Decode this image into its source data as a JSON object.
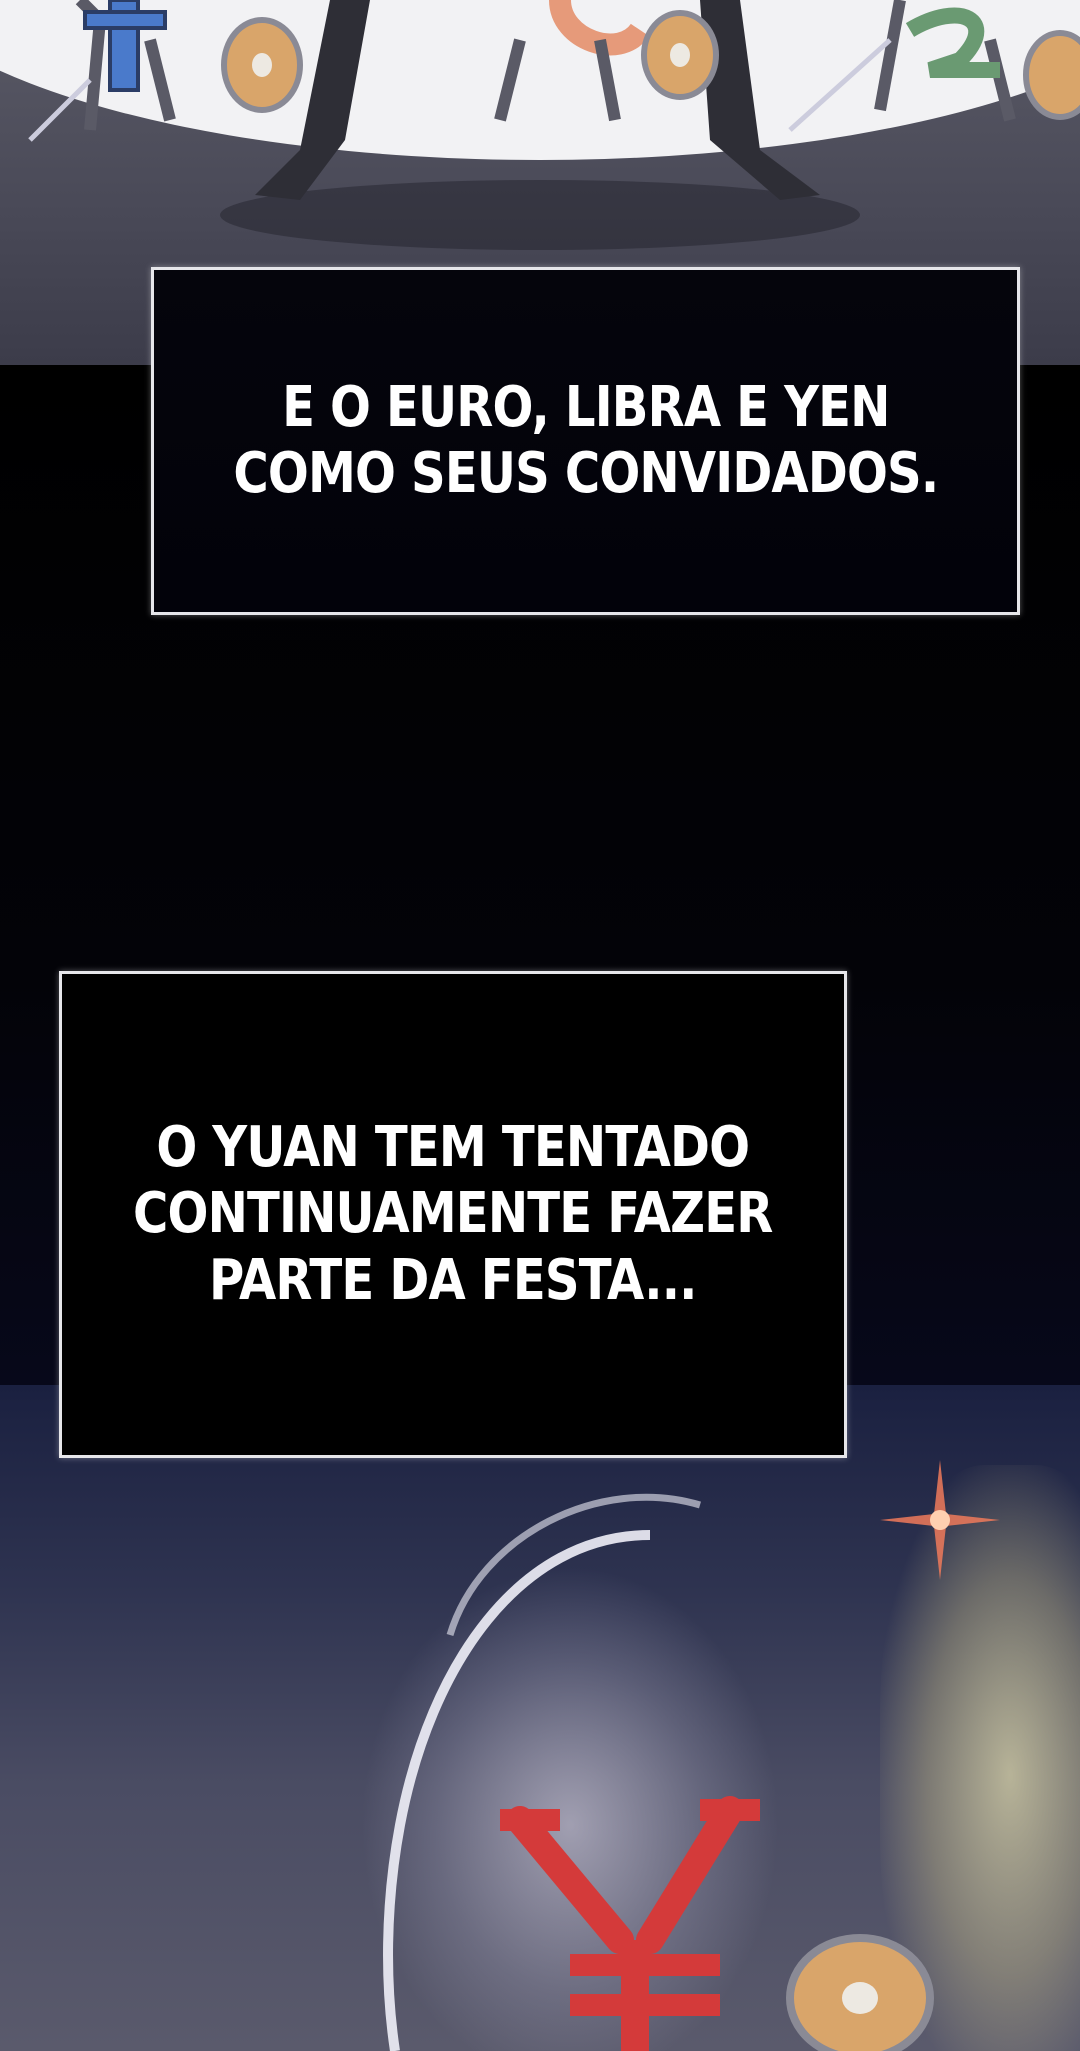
{
  "captions": [
    {
      "lines": [
        "E O EURO, LIBRA E YEN",
        "COMO SEUS CONVIDADOS."
      ]
    },
    {
      "lines": [
        "O YUAN TEM TENTADO",
        "CONTINUAMENTE FAZER",
        "PARTE DA FESTA..."
      ]
    }
  ],
  "colors": {
    "caption_background": "#000000",
    "caption_border": "#e6e6ea",
    "caption_text": "#ffffff",
    "euro_color": "#4a7acb",
    "libra_color": "#e69a7a",
    "yen_color": "#d43a3a",
    "pound_green": "#6a9a72",
    "shield_tan": "#d9a56a",
    "sparkle": "#f07a5a"
  },
  "icons": {
    "euro": "euro-character-icon",
    "pound": "pound-character-icon",
    "yen": "yen-character-icon",
    "shield": "shield-icon",
    "sparkle": "sparkle-icon"
  }
}
